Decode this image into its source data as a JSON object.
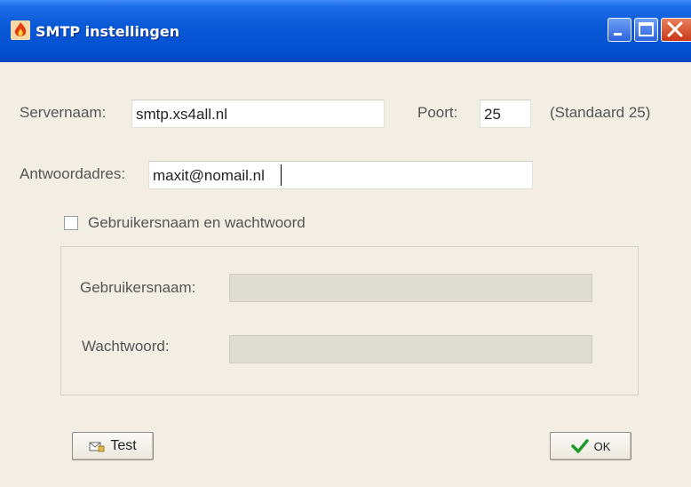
{
  "window": {
    "title": "SMTP instellingen",
    "icons": {
      "app": "app-flame-icon",
      "minimize": "minimize-icon",
      "maximize": "maximize-icon",
      "close": "close-icon"
    }
  },
  "form": {
    "server_label": "Servernaam:",
    "server_value": "smtp.xs4all.nl",
    "port_label": "Poort:",
    "port_value": "25",
    "port_hint": "(Standaard 25)",
    "reply_label": "Antwoordadres:",
    "reply_value": "maxit@nomail.nl",
    "auth_checkbox_label": "Gebruikersnaam en wachtwoord",
    "auth_checked": false,
    "username_label": "Gebruikersnaam:",
    "username_value": "",
    "password_label": "Wachtwoord:",
    "password_value": ""
  },
  "buttons": {
    "test_label": "Test",
    "test_icon": "envelope-test-icon",
    "ok_label": "OK",
    "ok_icon": "checkmark-icon"
  },
  "colors": {
    "titlebar": "#0451d2",
    "dialog_bg": "#f2eee4",
    "close_button": "#c83818",
    "ok_check": "#1f9a2a"
  }
}
